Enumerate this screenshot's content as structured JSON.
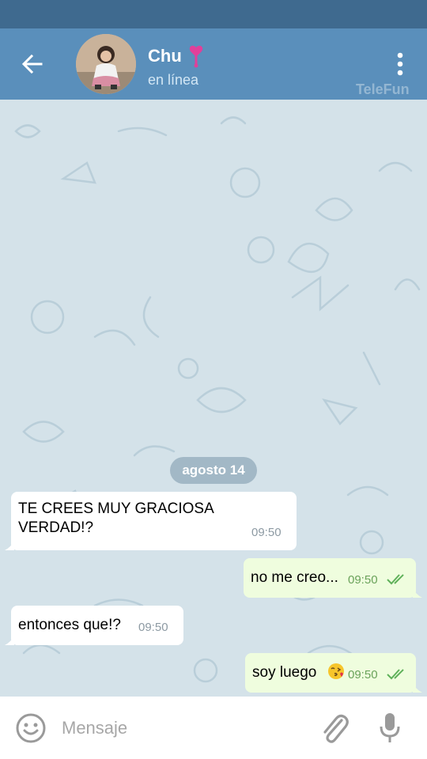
{
  "header": {
    "contact_name": "Chu",
    "status": "en línea",
    "watermark": "TeleFun"
  },
  "chat": {
    "date_label": "agosto 14",
    "messages": [
      {
        "direction": "incoming",
        "line1": "TE CREES MUY GRACIOSA",
        "line2": "VERDAD!?",
        "time": "09:50"
      },
      {
        "direction": "outgoing",
        "text": "no me creo...",
        "time": "09:50",
        "read": true
      },
      {
        "direction": "incoming",
        "text": "entonces que!?",
        "time": "09:50"
      },
      {
        "direction": "outgoing",
        "text": "soy luego",
        "time": "09:50",
        "read": true
      }
    ]
  },
  "input": {
    "placeholder": "Mensaje"
  },
  "icons": {
    "back": "arrow-left-icon",
    "menu": "more-vertical-icon",
    "emoji": "smiley-icon",
    "attach": "paperclip-icon",
    "mic": "microphone-icon"
  },
  "colors": {
    "status_bar": "#3f6a8f",
    "header": "#5a8fbb",
    "chat_background": "#d4e2e9",
    "incoming_bubble": "#ffffff",
    "outgoing_bubble": "#effdde",
    "read_ticks": "#5fb15a"
  }
}
